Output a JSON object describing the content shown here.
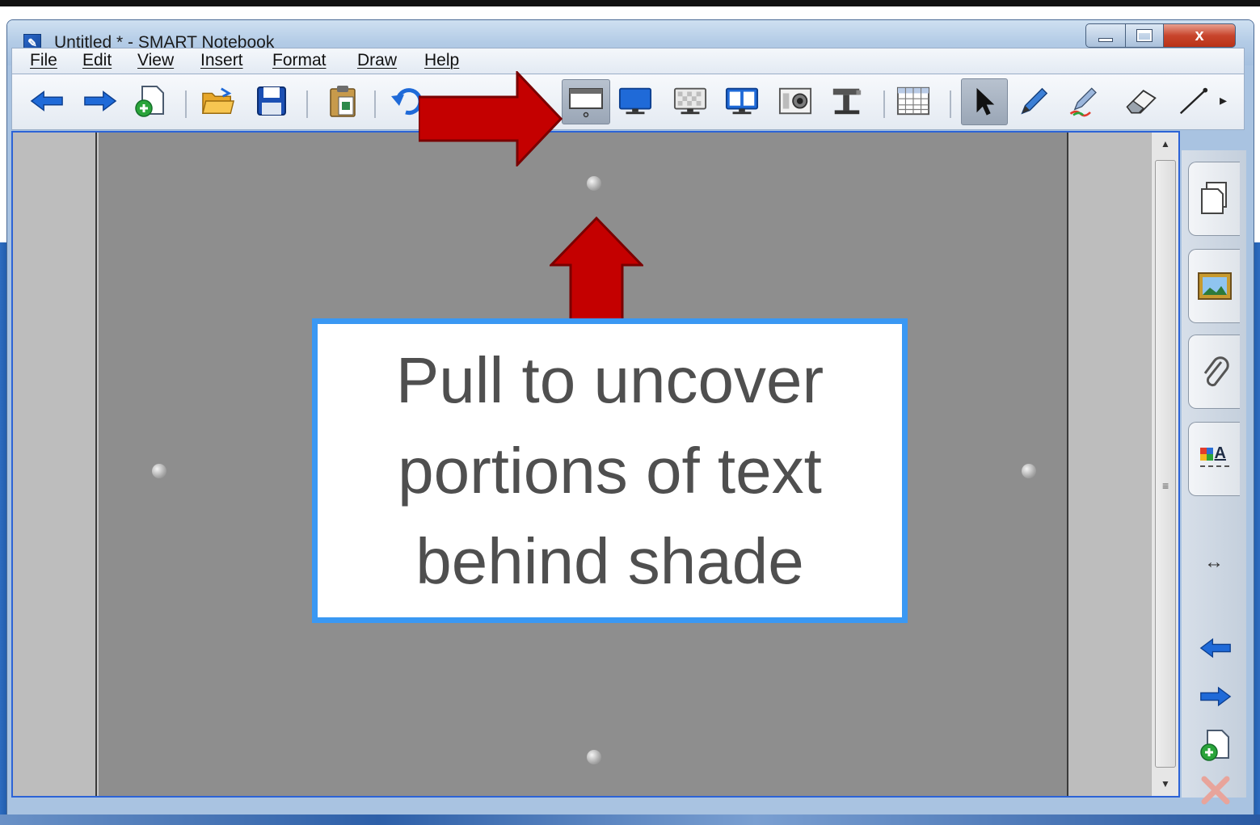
{
  "window": {
    "title": "Untitled * - SMART Notebook",
    "close_glyph": "x"
  },
  "menu": {
    "items": [
      "File",
      "Edit",
      "View",
      "Insert",
      "Format",
      "Draw",
      "Help"
    ]
  },
  "toolbar": {
    "buttons": [
      {
        "name": "previous-page-button",
        "icon": "arrow-left-icon"
      },
      {
        "name": "next-page-button",
        "icon": "arrow-right-icon"
      },
      {
        "name": "add-page-button",
        "icon": "add-page-icon"
      },
      {
        "name": "open-file-button",
        "icon": "folder-open-icon"
      },
      {
        "name": "save-button",
        "icon": "floppy-disk-icon"
      },
      {
        "name": "paste-button",
        "icon": "clipboard-icon"
      },
      {
        "name": "undo-button",
        "icon": "undo-icon"
      },
      {
        "name": "screen-shade-button",
        "icon": "screen-shade-icon",
        "active": true
      },
      {
        "name": "full-screen-button",
        "icon": "monitor-icon"
      },
      {
        "name": "transparent-background-button",
        "icon": "transparent-monitor-icon"
      },
      {
        "name": "dual-page-button",
        "icon": "dual-display-icon"
      },
      {
        "name": "screen-capture-button",
        "icon": "camera-icon"
      },
      {
        "name": "document-camera-button",
        "icon": "document-camera-icon"
      },
      {
        "name": "insert-table-button",
        "icon": "table-icon"
      },
      {
        "name": "select-button",
        "icon": "cursor-arrow-icon",
        "active": true
      },
      {
        "name": "pen-button",
        "icon": "pen-icon"
      },
      {
        "name": "creative-pen-button",
        "icon": "creative-pen-icon"
      },
      {
        "name": "eraser-button",
        "icon": "eraser-icon"
      },
      {
        "name": "line-button",
        "icon": "line-icon"
      }
    ],
    "more_glyph": "▸"
  },
  "side_panel": {
    "tabs": [
      "page-sorter-icon",
      "gallery-icon",
      "attachments-icon",
      "properties-icon"
    ],
    "move_glyph": "↔",
    "properties_label": "A"
  },
  "shade": {
    "close_glyph": "✕"
  },
  "callout": {
    "lines": [
      "Pull to uncover",
      "portions of text",
      "behind shade"
    ],
    "border_color": "#3a98f3",
    "text_color": "#4f4f4f"
  },
  "annotation_colors": {
    "arrow": "#c40000"
  }
}
